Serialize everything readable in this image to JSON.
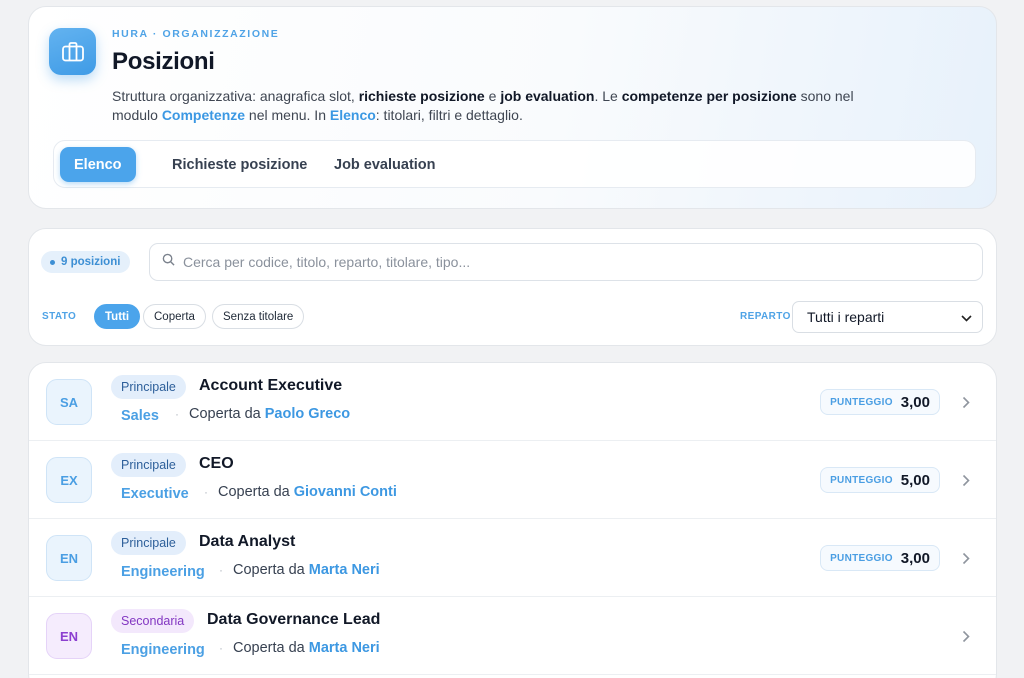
{
  "header": {
    "eyebrow": "HURA · ORGANIZZAZIONE",
    "title": "Posizioni",
    "description": {
      "p1": "Struttura organizzativa: anagrafica slot, ",
      "b1": "richieste posizione",
      "p2": " e ",
      "b2": "job evaluation",
      "p3": ". Le ",
      "b3": "competenze per posizione",
      "p4": " sono nel modulo ",
      "l1": "Competenze",
      "p5": " nel menu. In ",
      "l2": "Elenco",
      "p6": ": titolari, filtri e dettaglio."
    },
    "tabs": [
      {
        "label": "Elenco",
        "active": true
      },
      {
        "label": "Richieste posizione",
        "active": false
      },
      {
        "label": "Job evaluation",
        "active": false
      }
    ]
  },
  "filters": {
    "count_label": "9 posizioni",
    "search_placeholder": "Cerca per codice, titolo, reparto, titolare, tipo...",
    "search_value": "",
    "stato_label": "STATO",
    "chips": [
      {
        "label": "Tutti",
        "active": true
      },
      {
        "label": "Coperta",
        "active": false
      },
      {
        "label": "Senza titolare",
        "active": false
      }
    ],
    "reparto_label": "REPARTO",
    "reparto_value": "Tutti i reparti"
  },
  "positions": [
    {
      "initials": "SA",
      "type": "Principale",
      "title": "Account Executive",
      "department": "Sales",
      "holder_prefix": "Coperta da",
      "holder": "Paolo Greco",
      "score_label": "PUNTEGGIO",
      "score": "3,00"
    },
    {
      "initials": "EX",
      "type": "Principale",
      "title": "CEO",
      "department": "Executive",
      "holder_prefix": "Coperta da",
      "holder": "Giovanni Conti",
      "score_label": "PUNTEGGIO",
      "score": "5,00"
    },
    {
      "initials": "EN",
      "type": "Principale",
      "title": "Data Analyst",
      "department": "Engineering",
      "holder_prefix": "Coperta da",
      "holder": "Marta Neri",
      "score_label": "PUNTEGGIO",
      "score": "3,00"
    },
    {
      "initials": "EN",
      "type": "Secondaria",
      "title": "Data Governance Lead",
      "department": "Engineering",
      "holder_prefix": "Coperta da",
      "holder": "Marta Neri"
    }
  ],
  "colors": {
    "accent": "#4ba4eb",
    "secondary_badge": "#8337c2"
  }
}
